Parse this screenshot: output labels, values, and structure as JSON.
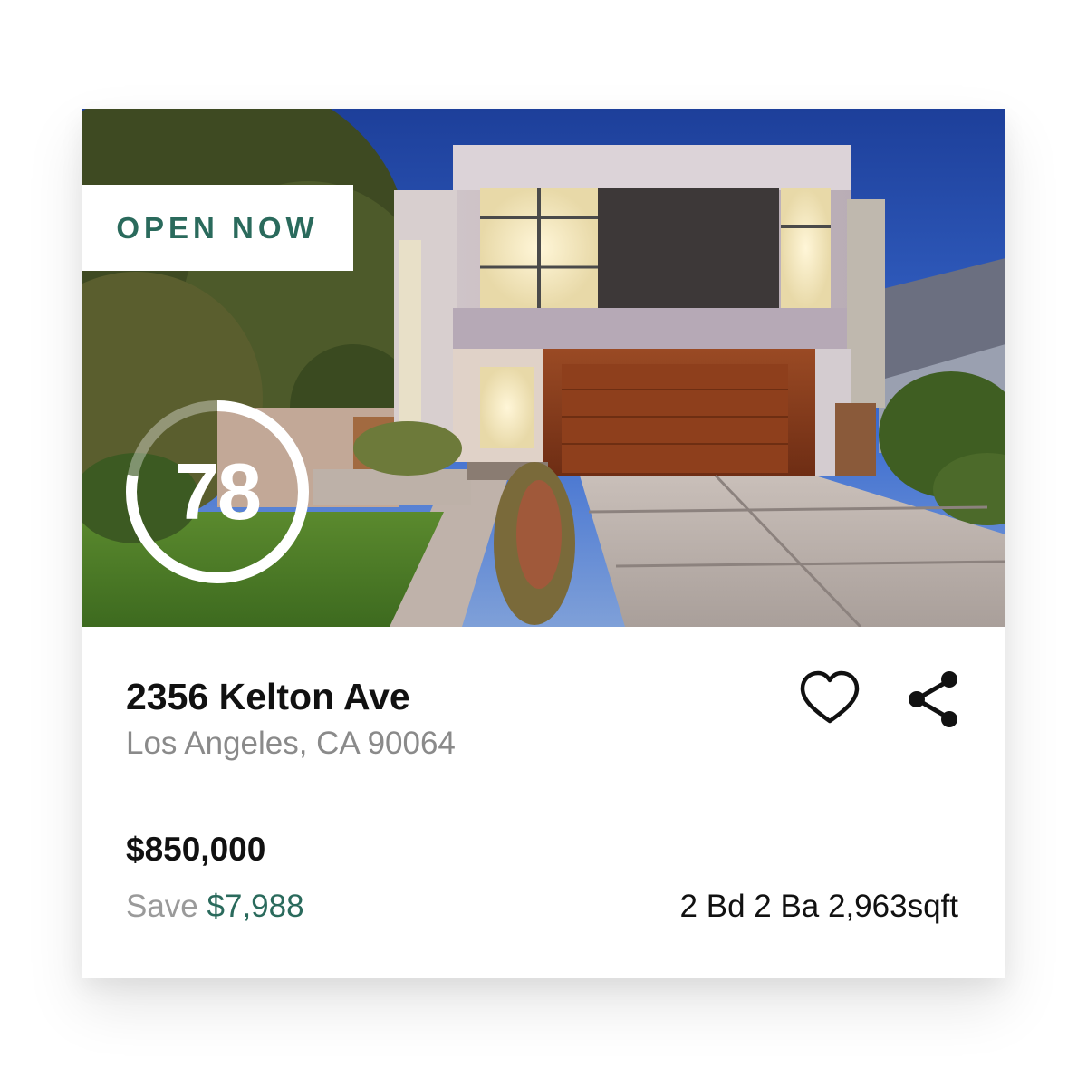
{
  "listing": {
    "badge": "OPEN NOW",
    "score": "78",
    "score_progress": 0.78,
    "address": "2356 Kelton Ave",
    "city": "Los Angeles, CA 90064",
    "price": "$850,000",
    "save_label": "Save",
    "save_amount": "$7,988",
    "specs": "2 Bd 2 Ba 2,963sqft"
  },
  "icons": {
    "favorite": "heart-icon",
    "share": "share-icon"
  },
  "colors": {
    "accent": "#2a6a5c",
    "muted_text": "#8a8a8a",
    "primary_text": "#111111"
  }
}
